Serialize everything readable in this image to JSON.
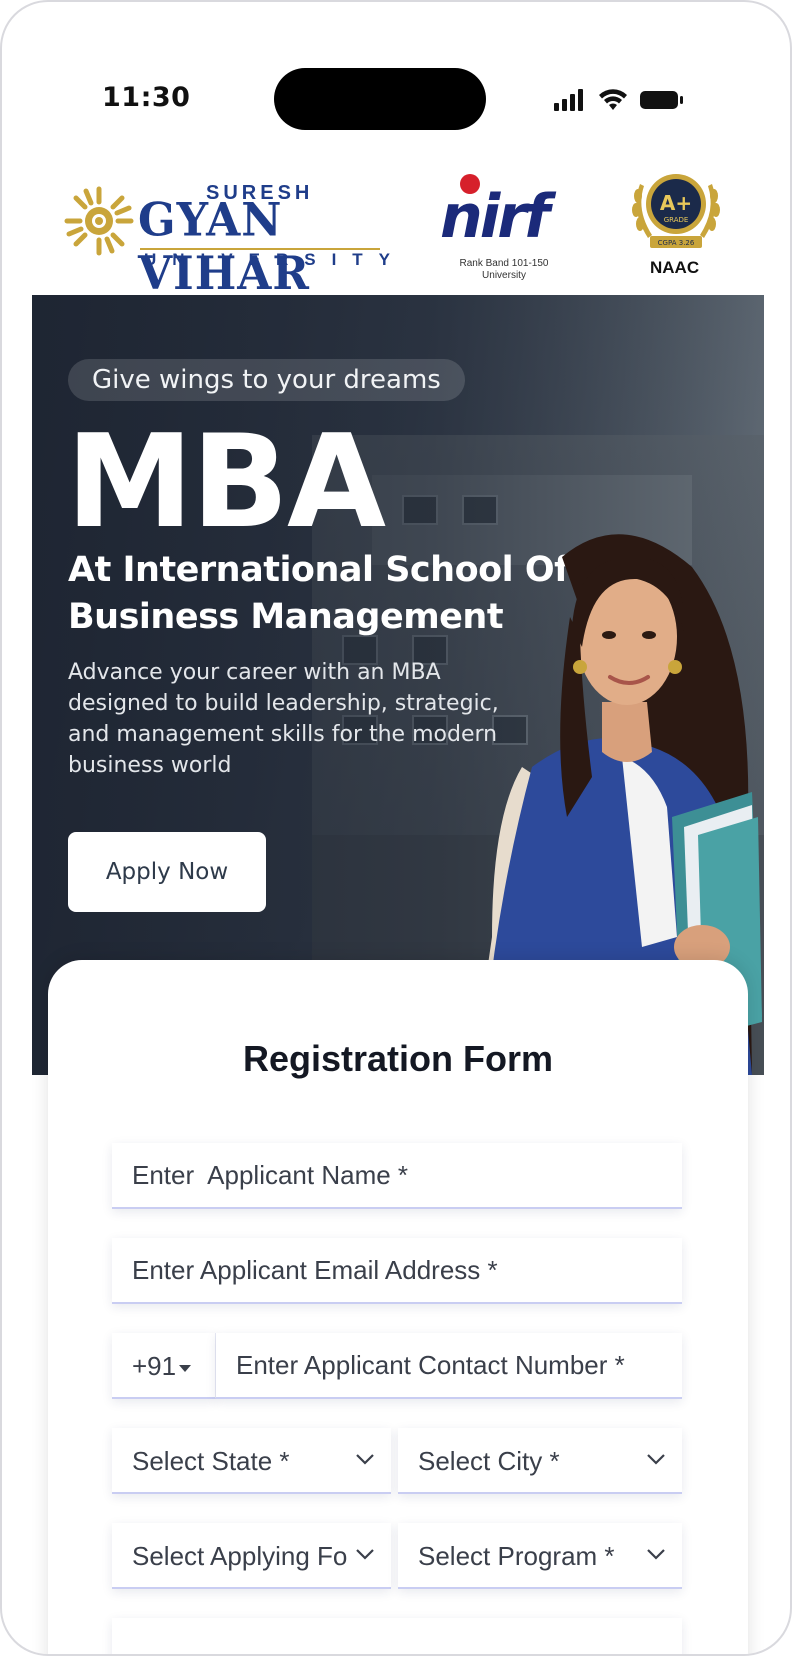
{
  "status_bar": {
    "time": "11:30"
  },
  "logos": {
    "sgvu": {
      "top": "SURESH",
      "main": "GYAN VIHAR",
      "bottom": "UNIVERSITY"
    },
    "nirf": {
      "word": "nirf",
      "subtitle": "Rank Band 101-150 University"
    },
    "naac": {
      "label": "NAAC",
      "badge": "A+",
      "badge_sub": "GRADE",
      "cgpa": "CGPA 3.26"
    }
  },
  "hero": {
    "tagline": "Give wings to your dreams",
    "title": "MBA",
    "subtitle": "At International School Of Business Management",
    "description": "Advance your career with an MBA designed to build leadership, strategic, and management skills for the modern business world",
    "apply_label": "Apply Now"
  },
  "form": {
    "title": "Registration Form",
    "name_placeholder": "Enter  Applicant Name *",
    "email_placeholder": "Enter Applicant Email Address *",
    "country_code": "+91",
    "phone_placeholder": "Enter Applicant Contact Number *",
    "state_select": "Select State *",
    "city_select": "Select City *",
    "applying_for_select": "Select Applying For *",
    "program_select": "Select Program *"
  },
  "colors": {
    "brand_blue": "#1f3d8a",
    "nirf_red": "#d6202b",
    "hero_bg": "#2b3442",
    "field_border": "#c9cdf2"
  }
}
